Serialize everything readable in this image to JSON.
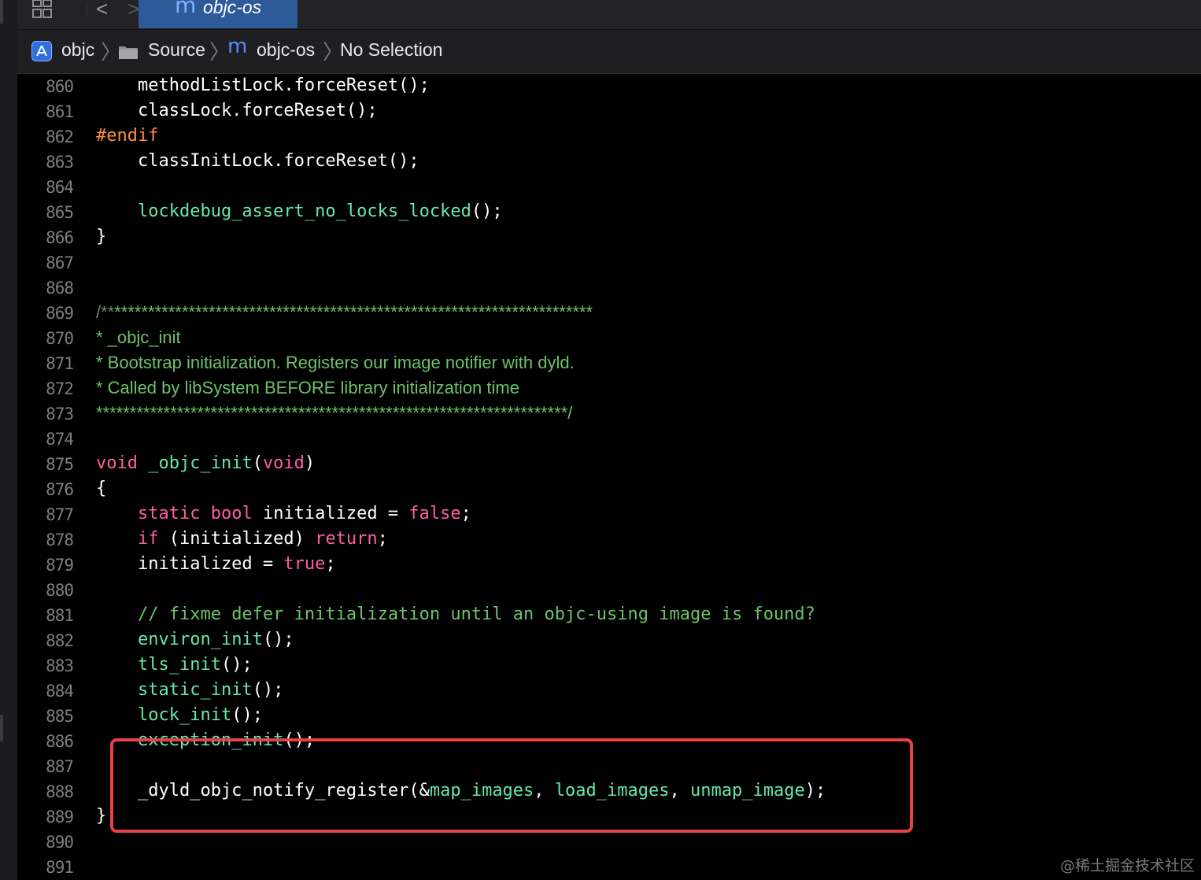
{
  "tabbar": {
    "tab_title": "objc-os",
    "tab_icon": "m",
    "back_glyph": "<",
    "forward_glyph": ">"
  },
  "breadcrumb": {
    "project": "objc",
    "folder": "Source",
    "file_icon": "m",
    "file": "objc-os",
    "selection": "No Selection",
    "separator": "〉"
  },
  "code": {
    "lines": [
      {
        "n": "860",
        "tokens": [
          [
            "plain",
            "    methodListLock.forceReset();"
          ]
        ]
      },
      {
        "n": "861",
        "tokens": [
          [
            "plain",
            "    classLock.forceReset();"
          ]
        ]
      },
      {
        "n": "862",
        "tokens": [
          [
            "prep",
            "#endif"
          ]
        ]
      },
      {
        "n": "863",
        "tokens": [
          [
            "plain",
            "    classInitLock.forceReset();"
          ]
        ]
      },
      {
        "n": "864",
        "tokens": []
      },
      {
        "n": "865",
        "tokens": [
          [
            "plain",
            "    "
          ],
          [
            "fn",
            "lockdebug_assert_no_locks_locked"
          ],
          [
            "plain",
            "();"
          ]
        ]
      },
      {
        "n": "866",
        "tokens": [
          [
            "plain",
            "}"
          ]
        ]
      },
      {
        "n": "867",
        "tokens": []
      },
      {
        "n": "868",
        "tokens": []
      },
      {
        "n": "869",
        "style": "prose",
        "tokens": [
          [
            "cmt-dim",
            "/**"
          ],
          [
            "cmt",
            "***********************************************************************"
          ]
        ]
      },
      {
        "n": "870",
        "style": "prose",
        "tokens": [
          [
            "cmt",
            "* _objc_init"
          ]
        ]
      },
      {
        "n": "871",
        "style": "prose",
        "tokens": [
          [
            "cmt",
            "* Bootstrap initialization. Registers our image notifier with dyld."
          ]
        ]
      },
      {
        "n": "872",
        "style": "prose",
        "tokens": [
          [
            "cmt",
            "* Called by libSystem BEFORE library initialization time"
          ]
        ]
      },
      {
        "n": "873",
        "style": "prose",
        "tokens": [
          [
            "cmt",
            "**********************************************************************/"
          ]
        ]
      },
      {
        "n": "874",
        "tokens": []
      },
      {
        "n": "875",
        "tokens": [
          [
            "kw",
            "void"
          ],
          [
            "plain",
            " "
          ],
          [
            "fn",
            "_objc_init"
          ],
          [
            "plain",
            "("
          ],
          [
            "kw",
            "void"
          ],
          [
            "plain",
            ")"
          ]
        ]
      },
      {
        "n": "876",
        "tokens": [
          [
            "plain",
            "{"
          ]
        ]
      },
      {
        "n": "877",
        "tokens": [
          [
            "plain",
            "    "
          ],
          [
            "kw",
            "static"
          ],
          [
            "plain",
            " "
          ],
          [
            "kw",
            "bool"
          ],
          [
            "plain",
            " initialized = "
          ],
          [
            "kw",
            "false"
          ],
          [
            "plain",
            ";"
          ]
        ]
      },
      {
        "n": "878",
        "tokens": [
          [
            "plain",
            "    "
          ],
          [
            "kw",
            "if"
          ],
          [
            "plain",
            " (initialized) "
          ],
          [
            "kw",
            "return"
          ],
          [
            "plain",
            ";"
          ]
        ]
      },
      {
        "n": "879",
        "tokens": [
          [
            "plain",
            "    initialized = "
          ],
          [
            "kw",
            "true"
          ],
          [
            "plain",
            ";"
          ]
        ]
      },
      {
        "n": "880",
        "tokens": []
      },
      {
        "n": "881",
        "tokens": [
          [
            "plain",
            "    "
          ],
          [
            "cmt",
            "// fixme defer initialization until an objc-using image is found?"
          ]
        ]
      },
      {
        "n": "882",
        "tokens": [
          [
            "plain",
            "    "
          ],
          [
            "fn",
            "environ_init"
          ],
          [
            "plain",
            "();"
          ]
        ]
      },
      {
        "n": "883",
        "tokens": [
          [
            "plain",
            "    "
          ],
          [
            "fn",
            "tls_init"
          ],
          [
            "plain",
            "();"
          ]
        ]
      },
      {
        "n": "884",
        "tokens": [
          [
            "plain",
            "    "
          ],
          [
            "fn",
            "static_init"
          ],
          [
            "plain",
            "();"
          ]
        ]
      },
      {
        "n": "885",
        "tokens": [
          [
            "plain",
            "    "
          ],
          [
            "fn",
            "lock_init"
          ],
          [
            "plain",
            "();"
          ]
        ]
      },
      {
        "n": "886",
        "tokens": [
          [
            "plain",
            "    "
          ],
          [
            "fn",
            "exception_init"
          ],
          [
            "plain",
            "();"
          ]
        ]
      },
      {
        "n": "887",
        "tokens": []
      },
      {
        "n": "888",
        "tokens": [
          [
            "plain",
            "    _dyld_objc_notify_register(&"
          ],
          [
            "fn",
            "map_images"
          ],
          [
            "plain",
            ", "
          ],
          [
            "fn",
            "load_images"
          ],
          [
            "plain",
            ", "
          ],
          [
            "fn",
            "unmap_image"
          ],
          [
            "plain",
            ");"
          ]
        ]
      },
      {
        "n": "889",
        "tokens": [
          [
            "plain",
            "}"
          ]
        ]
      },
      {
        "n": "890",
        "tokens": []
      },
      {
        "n": "891",
        "tokens": []
      }
    ]
  },
  "colors": {
    "keyword": "#fc5fa3",
    "preprocessor": "#fd8f3f",
    "function": "#67e8a9",
    "comment": "#6cc26a",
    "highlight_box": "#e5434a"
  },
  "watermark": "@稀土掘金技术社区"
}
